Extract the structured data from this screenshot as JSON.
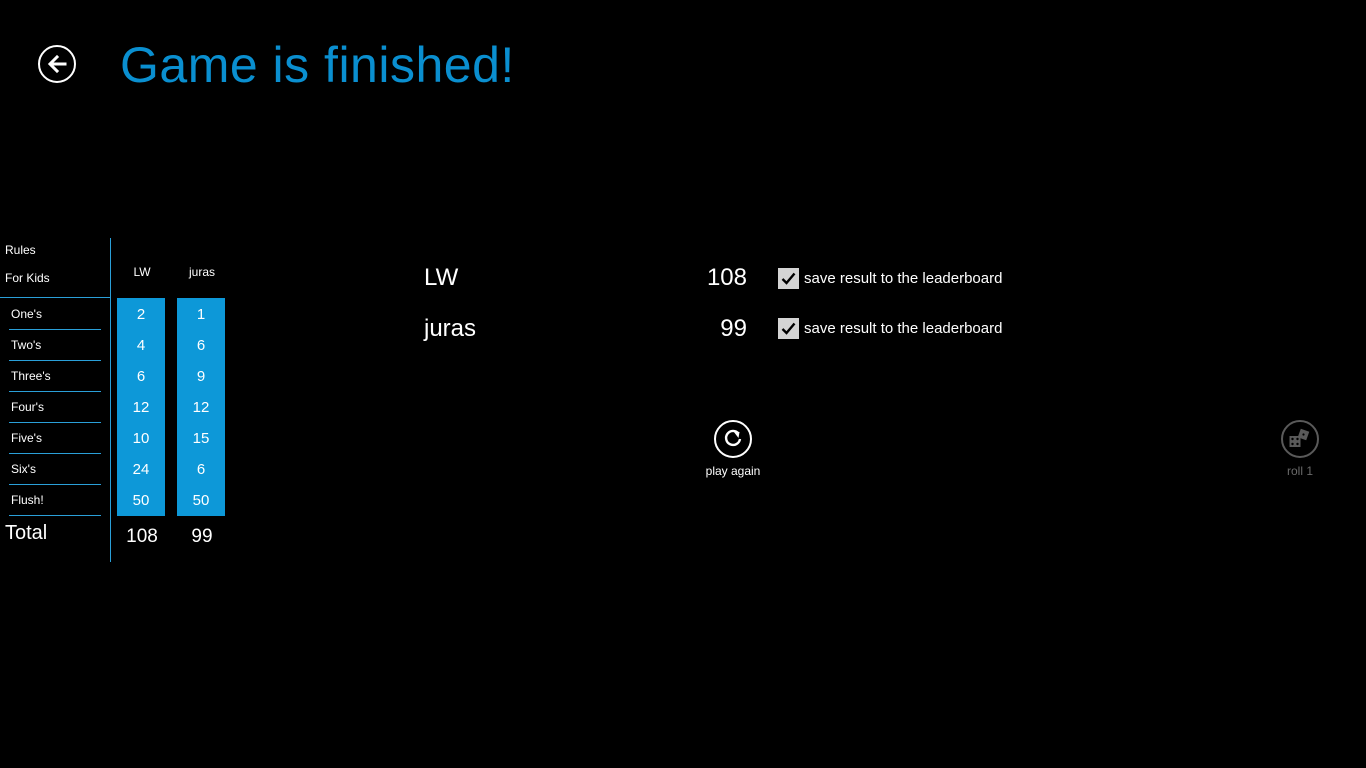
{
  "header": {
    "title": "Game is finished!"
  },
  "scoreboard": {
    "rules_label": "Rules",
    "for_kids_label": "For Kids",
    "players": [
      "LW",
      "juras"
    ],
    "rows": [
      {
        "label": "One's",
        "scores": [
          "2",
          "1"
        ]
      },
      {
        "label": "Two's",
        "scores": [
          "4",
          "6"
        ]
      },
      {
        "label": "Three's",
        "scores": [
          "6",
          "9"
        ]
      },
      {
        "label": "Four's",
        "scores": [
          "12",
          "12"
        ]
      },
      {
        "label": "Five's",
        "scores": [
          "10",
          "15"
        ]
      },
      {
        "label": "Six's",
        "scores": [
          "24",
          "6"
        ]
      },
      {
        "label": "Flush!",
        "scores": [
          "50",
          "50"
        ]
      }
    ],
    "total_label": "Total",
    "totals": [
      "108",
      "99"
    ]
  },
  "results": [
    {
      "name": "LW",
      "score": "108",
      "save_label": "save result to the leaderboard",
      "checked": true
    },
    {
      "name": "juras",
      "score": "99",
      "save_label": "save result to the leaderboard",
      "checked": true
    }
  ],
  "actions": {
    "play_again_label": "play again",
    "roll_label": "roll 1"
  },
  "colors": {
    "accent": "#0a8fd0",
    "score_column": "#0d98d8",
    "divider": "#2a9fd8",
    "background": "#000000"
  }
}
